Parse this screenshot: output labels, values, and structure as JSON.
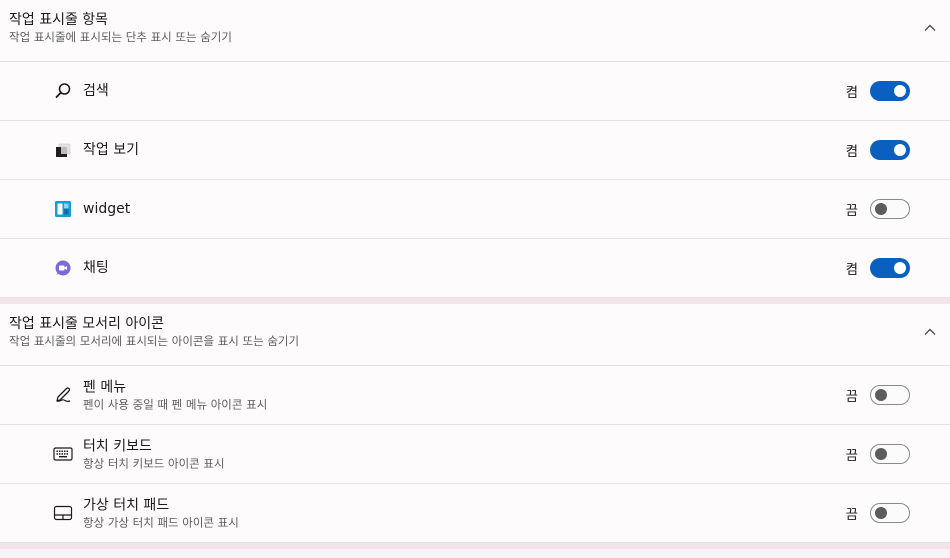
{
  "taskbar_items": {
    "title": "작업 표시줄 항목",
    "description": "작업 표시줄에 표시되는 단추 표시 또는 숨기기",
    "items": [
      {
        "label": "검색",
        "state": "켬",
        "on": true,
        "icon": "search-icon"
      },
      {
        "label": "작업 보기",
        "state": "켬",
        "on": true,
        "icon": "task-view-icon"
      },
      {
        "label": "widget",
        "state": "끔",
        "on": false,
        "icon": "widgets-icon"
      },
      {
        "label": "채팅",
        "state": "켬",
        "on": true,
        "icon": "chat-icon"
      }
    ]
  },
  "corner_icons": {
    "title": "작업 표시줄 모서리 아이콘",
    "description": "작업 표시줄의 모서리에 표시되는 아이콘을 표시 또는 숨기기",
    "items": [
      {
        "label": "펜 메뉴",
        "sub": "펜이 사용 중일 때 펜 메뉴 아이콘 표시",
        "state": "끔",
        "on": false,
        "icon": "pen-icon"
      },
      {
        "label": "터치 키보드",
        "sub": "항상 터치 키보드 아이콘 표시",
        "state": "끔",
        "on": false,
        "icon": "keyboard-icon"
      },
      {
        "label": "가상 터치 패드",
        "sub": "항상 가상 터치 패드 아이콘 표시",
        "state": "끔",
        "on": false,
        "icon": "touchpad-icon"
      }
    ]
  },
  "colors": {
    "accent": "#0a5fbf",
    "chat": "#7b6ad8",
    "widgets": "#1a9bd7"
  }
}
